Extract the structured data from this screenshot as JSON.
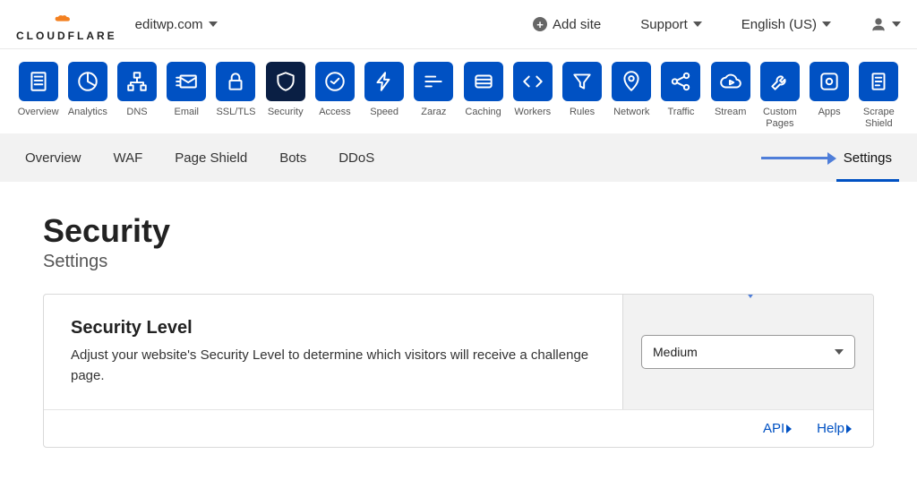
{
  "header": {
    "brand": "CLOUDFLARE",
    "site": "editwp.com",
    "add_site": "Add site",
    "support": "Support",
    "lang": "English (US)"
  },
  "nav": [
    {
      "key": "overview",
      "label": "Overview"
    },
    {
      "key": "analytics",
      "label": "Analytics"
    },
    {
      "key": "dns",
      "label": "DNS"
    },
    {
      "key": "email",
      "label": "Email"
    },
    {
      "key": "ssltls",
      "label": "SSL/TLS"
    },
    {
      "key": "security",
      "label": "Security"
    },
    {
      "key": "access",
      "label": "Access"
    },
    {
      "key": "speed",
      "label": "Speed"
    },
    {
      "key": "zaraz",
      "label": "Zaraz"
    },
    {
      "key": "caching",
      "label": "Caching"
    },
    {
      "key": "workers",
      "label": "Workers"
    },
    {
      "key": "rules",
      "label": "Rules"
    },
    {
      "key": "network",
      "label": "Network"
    },
    {
      "key": "traffic",
      "label": "Traffic"
    },
    {
      "key": "stream",
      "label": "Stream"
    },
    {
      "key": "custom-pages",
      "label": "Custom Pages"
    },
    {
      "key": "apps",
      "label": "Apps"
    },
    {
      "key": "scrape-shield",
      "label": "Scrape Shield"
    }
  ],
  "subnav": {
    "items": [
      "Overview",
      "WAF",
      "Page Shield",
      "Bots",
      "DDoS"
    ],
    "active": "Settings"
  },
  "page": {
    "title": "Security",
    "subtitle": "Settings"
  },
  "card": {
    "title": "Security Level",
    "desc": "Adjust your website's Security Level to determine which visitors will receive a challenge page.",
    "select_value": "Medium",
    "api": "API",
    "help": "Help"
  }
}
